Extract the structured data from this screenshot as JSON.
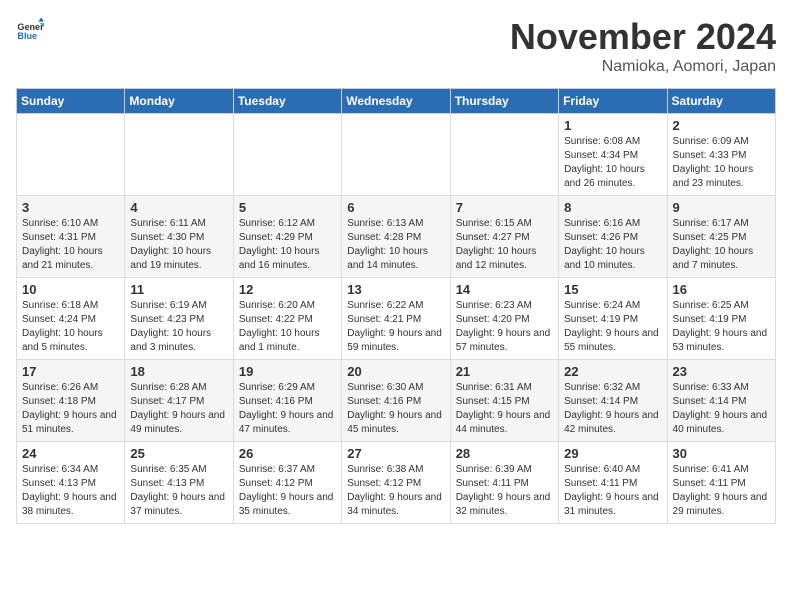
{
  "logo": {
    "general": "General",
    "blue": "Blue"
  },
  "header": {
    "month": "November 2024",
    "location": "Namioka, Aomori, Japan"
  },
  "days_of_week": [
    "Sunday",
    "Monday",
    "Tuesday",
    "Wednesday",
    "Thursday",
    "Friday",
    "Saturday"
  ],
  "weeks": [
    [
      {
        "day": "",
        "detail": ""
      },
      {
        "day": "",
        "detail": ""
      },
      {
        "day": "",
        "detail": ""
      },
      {
        "day": "",
        "detail": ""
      },
      {
        "day": "",
        "detail": ""
      },
      {
        "day": "1",
        "detail": "Sunrise: 6:08 AM\nSunset: 4:34 PM\nDaylight: 10 hours and 26 minutes."
      },
      {
        "day": "2",
        "detail": "Sunrise: 6:09 AM\nSunset: 4:33 PM\nDaylight: 10 hours and 23 minutes."
      }
    ],
    [
      {
        "day": "3",
        "detail": "Sunrise: 6:10 AM\nSunset: 4:31 PM\nDaylight: 10 hours and 21 minutes."
      },
      {
        "day": "4",
        "detail": "Sunrise: 6:11 AM\nSunset: 4:30 PM\nDaylight: 10 hours and 19 minutes."
      },
      {
        "day": "5",
        "detail": "Sunrise: 6:12 AM\nSunset: 4:29 PM\nDaylight: 10 hours and 16 minutes."
      },
      {
        "day": "6",
        "detail": "Sunrise: 6:13 AM\nSunset: 4:28 PM\nDaylight: 10 hours and 14 minutes."
      },
      {
        "day": "7",
        "detail": "Sunrise: 6:15 AM\nSunset: 4:27 PM\nDaylight: 10 hours and 12 minutes."
      },
      {
        "day": "8",
        "detail": "Sunrise: 6:16 AM\nSunset: 4:26 PM\nDaylight: 10 hours and 10 minutes."
      },
      {
        "day": "9",
        "detail": "Sunrise: 6:17 AM\nSunset: 4:25 PM\nDaylight: 10 hours and 7 minutes."
      }
    ],
    [
      {
        "day": "10",
        "detail": "Sunrise: 6:18 AM\nSunset: 4:24 PM\nDaylight: 10 hours and 5 minutes."
      },
      {
        "day": "11",
        "detail": "Sunrise: 6:19 AM\nSunset: 4:23 PM\nDaylight: 10 hours and 3 minutes."
      },
      {
        "day": "12",
        "detail": "Sunrise: 6:20 AM\nSunset: 4:22 PM\nDaylight: 10 hours and 1 minute."
      },
      {
        "day": "13",
        "detail": "Sunrise: 6:22 AM\nSunset: 4:21 PM\nDaylight: 9 hours and 59 minutes."
      },
      {
        "day": "14",
        "detail": "Sunrise: 6:23 AM\nSunset: 4:20 PM\nDaylight: 9 hours and 57 minutes."
      },
      {
        "day": "15",
        "detail": "Sunrise: 6:24 AM\nSunset: 4:19 PM\nDaylight: 9 hours and 55 minutes."
      },
      {
        "day": "16",
        "detail": "Sunrise: 6:25 AM\nSunset: 4:19 PM\nDaylight: 9 hours and 53 minutes."
      }
    ],
    [
      {
        "day": "17",
        "detail": "Sunrise: 6:26 AM\nSunset: 4:18 PM\nDaylight: 9 hours and 51 minutes."
      },
      {
        "day": "18",
        "detail": "Sunrise: 6:28 AM\nSunset: 4:17 PM\nDaylight: 9 hours and 49 minutes."
      },
      {
        "day": "19",
        "detail": "Sunrise: 6:29 AM\nSunset: 4:16 PM\nDaylight: 9 hours and 47 minutes."
      },
      {
        "day": "20",
        "detail": "Sunrise: 6:30 AM\nSunset: 4:16 PM\nDaylight: 9 hours and 45 minutes."
      },
      {
        "day": "21",
        "detail": "Sunrise: 6:31 AM\nSunset: 4:15 PM\nDaylight: 9 hours and 44 minutes."
      },
      {
        "day": "22",
        "detail": "Sunrise: 6:32 AM\nSunset: 4:14 PM\nDaylight: 9 hours and 42 minutes."
      },
      {
        "day": "23",
        "detail": "Sunrise: 6:33 AM\nSunset: 4:14 PM\nDaylight: 9 hours and 40 minutes."
      }
    ],
    [
      {
        "day": "24",
        "detail": "Sunrise: 6:34 AM\nSunset: 4:13 PM\nDaylight: 9 hours and 38 minutes."
      },
      {
        "day": "25",
        "detail": "Sunrise: 6:35 AM\nSunset: 4:13 PM\nDaylight: 9 hours and 37 minutes."
      },
      {
        "day": "26",
        "detail": "Sunrise: 6:37 AM\nSunset: 4:12 PM\nDaylight: 9 hours and 35 minutes."
      },
      {
        "day": "27",
        "detail": "Sunrise: 6:38 AM\nSunset: 4:12 PM\nDaylight: 9 hours and 34 minutes."
      },
      {
        "day": "28",
        "detail": "Sunrise: 6:39 AM\nSunset: 4:11 PM\nDaylight: 9 hours and 32 minutes."
      },
      {
        "day": "29",
        "detail": "Sunrise: 6:40 AM\nSunset: 4:11 PM\nDaylight: 9 hours and 31 minutes."
      },
      {
        "day": "30",
        "detail": "Sunrise: 6:41 AM\nSunset: 4:11 PM\nDaylight: 9 hours and 29 minutes."
      }
    ]
  ]
}
